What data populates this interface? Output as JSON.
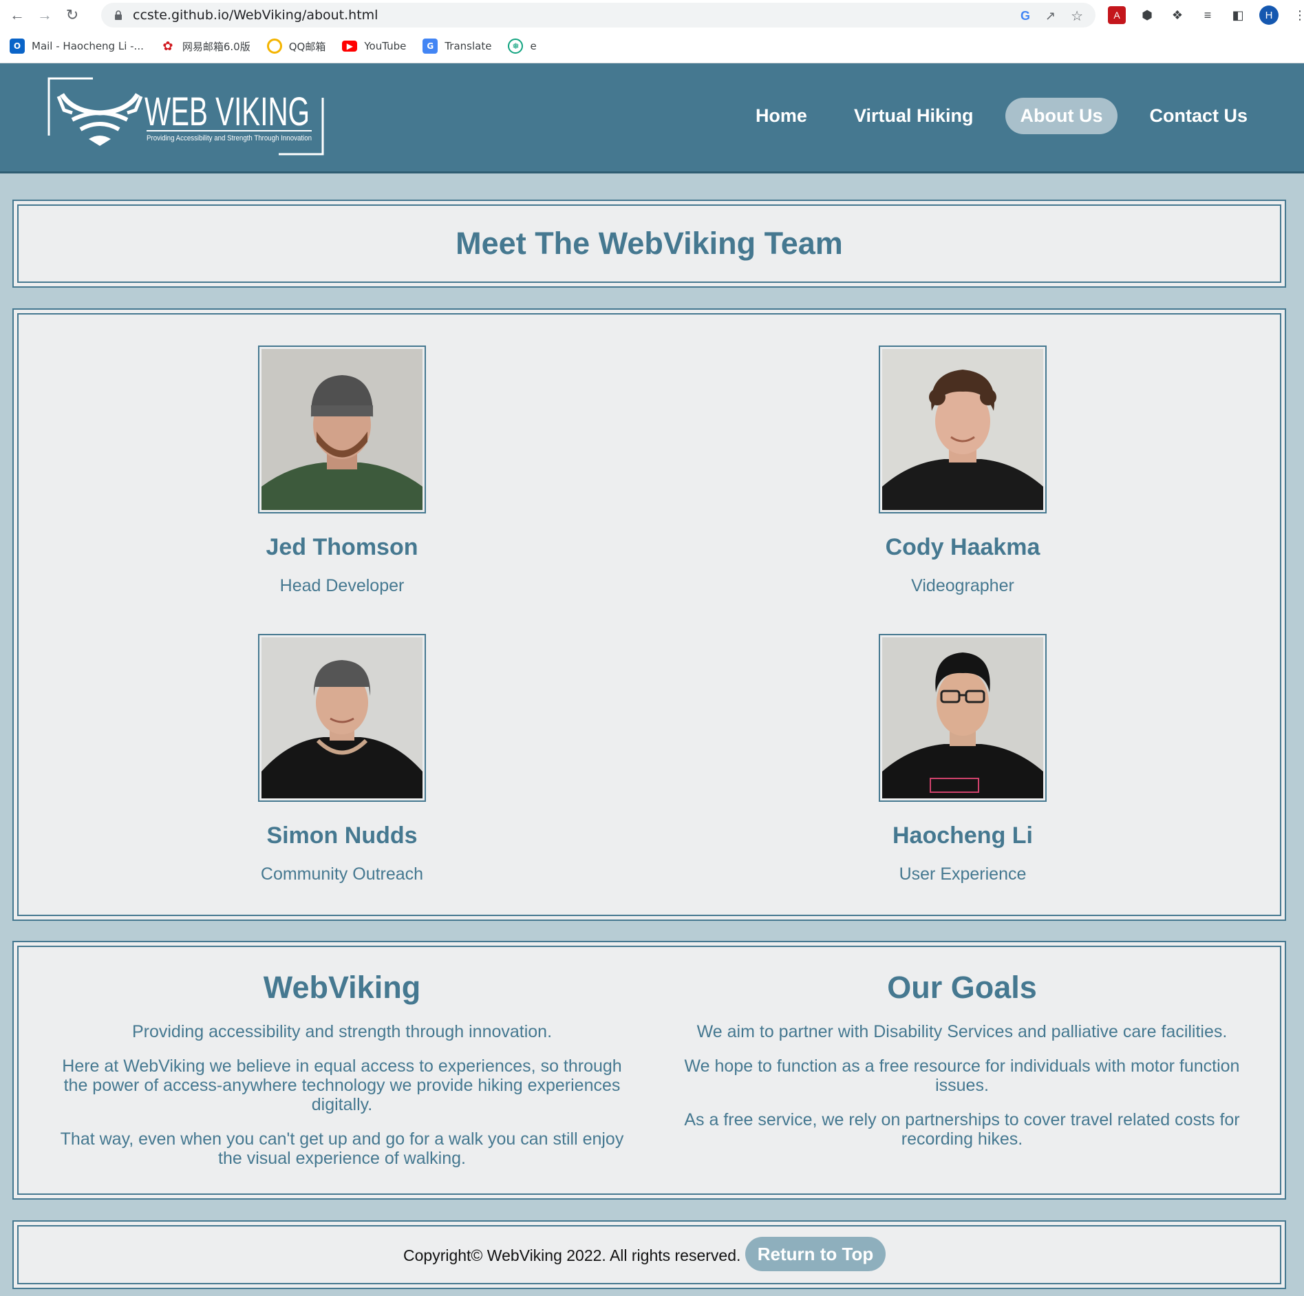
{
  "browser": {
    "url": "ccste.github.io/WebViking/about.html",
    "avatar_letter": "H",
    "bookmarks": [
      {
        "label": "Mail - Haocheng Li -...",
        "icon": "outlook-icon"
      },
      {
        "label": "网易邮箱6.0版",
        "icon": "netease-mail-icon"
      },
      {
        "label": "QQ邮箱",
        "icon": "qq-mail-icon"
      },
      {
        "label": "YouTube",
        "icon": "youtube-icon"
      },
      {
        "label": "Translate",
        "icon": "translate-icon"
      },
      {
        "label": "e",
        "icon": "chatgpt-icon"
      }
    ]
  },
  "site": {
    "logo": {
      "title": "WEB VIKING",
      "tagline": "Providing Accessibility and Strength Through Innovation"
    },
    "nav": [
      "Home",
      "Virtual Hiking",
      "About Us",
      "Contact Us"
    ],
    "active_nav": "About Us",
    "accent_color": "#457890"
  },
  "team": {
    "heading": "Meet The WebViking Team",
    "members": [
      {
        "name": "Jed Thomson",
        "role": "Head Developer"
      },
      {
        "name": "Cody Haakma",
        "role": "Videographer"
      },
      {
        "name": "Simon Nudds",
        "role": "Community Outreach"
      },
      {
        "name": "Haocheng Li",
        "role": "User Experience"
      }
    ]
  },
  "about": {
    "title": "WebViking",
    "paragraphs": [
      "Providing accessibility and strength through innovation.",
      "Here at WebViking we believe in equal access to experiences, so through the power of access-anywhere technology we provide hiking experiences digitally.",
      "That way, even when you can't get up and go for a walk you can still enjoy the visual experience of walking."
    ]
  },
  "goals": {
    "title": "Our Goals",
    "paragraphs": [
      "We aim to partner with Disability Services and palliative care facilities.",
      "We hope to function as a free resource for individuals with motor function issues.",
      "As a free service, we rely on partnerships to cover travel related costs for recording hikes."
    ]
  },
  "footer": {
    "copyright": "Copyright© WebViking 2022. All rights reserved.",
    "return_button": "Return to Top"
  }
}
